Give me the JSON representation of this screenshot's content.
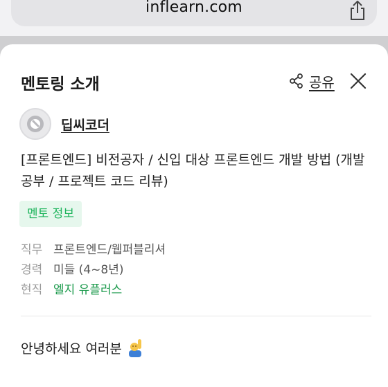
{
  "browser": {
    "url": "inflearn.com"
  },
  "sheet": {
    "title": "멘토링 소개",
    "share_label": "공유"
  },
  "mentor": {
    "name": "딥씨코더"
  },
  "headline": "[프론트엔드] 비전공자 / 신입 대상 프론트엔드 개발 방법 (개발 공부 / 프로젝트 코드 리뷰)",
  "badge": "멘토 정보",
  "info": [
    {
      "key": "직무",
      "value": "프론트엔드/웹퍼블리셔"
    },
    {
      "key": "경력",
      "value": "미들 (4~8년)"
    },
    {
      "key": "현직",
      "value": "엘지 유플러스"
    }
  ],
  "greeting": "안녕하세요 여러분",
  "colors": {
    "accent_green": "#1bb35a",
    "badge_bg": "#e6f7ed"
  }
}
